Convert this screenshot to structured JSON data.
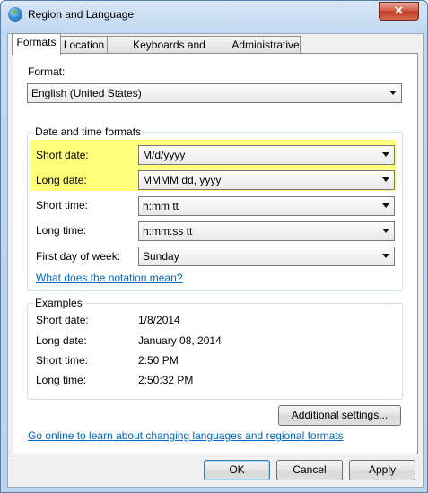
{
  "window": {
    "title": "Region and Language",
    "close_glyph": "✕"
  },
  "tabs": [
    {
      "label": "Formats",
      "active": true
    },
    {
      "label": "Location"
    },
    {
      "label": "Keyboards and Languages"
    },
    {
      "label": "Administrative"
    }
  ],
  "format": {
    "label": "Format:",
    "value": "English (United States)"
  },
  "datetime": {
    "group_title": "Date and time formats",
    "short_date": {
      "label": "Short date:",
      "value": "M/d/yyyy"
    },
    "long_date": {
      "label": "Long date:",
      "value": "MMMM dd, yyyy"
    },
    "short_time": {
      "label": "Short time:",
      "value": "h:mm tt"
    },
    "long_time": {
      "label": "Long time:",
      "value": "h:mm:ss tt"
    },
    "first_day": {
      "label": "First day of week:",
      "value": "Sunday"
    },
    "notation_link": "What does the notation mean?"
  },
  "examples": {
    "group_title": "Examples",
    "short_date": {
      "label": "Short date:",
      "value": "1/8/2014"
    },
    "long_date": {
      "label": "Long date:",
      "value": "January 08, 2014"
    },
    "short_time": {
      "label": "Short time:",
      "value": "2:50 PM"
    },
    "long_time": {
      "label": "Long time:",
      "value": "2:50:32 PM"
    }
  },
  "additional_settings": "Additional settings...",
  "online_link": "Go online to learn about changing languages and regional formats",
  "buttons": {
    "ok": "OK",
    "cancel": "Cancel",
    "apply": "Apply"
  },
  "colors": {
    "highlight": "#ffff7a",
    "link": "#0066cc"
  }
}
